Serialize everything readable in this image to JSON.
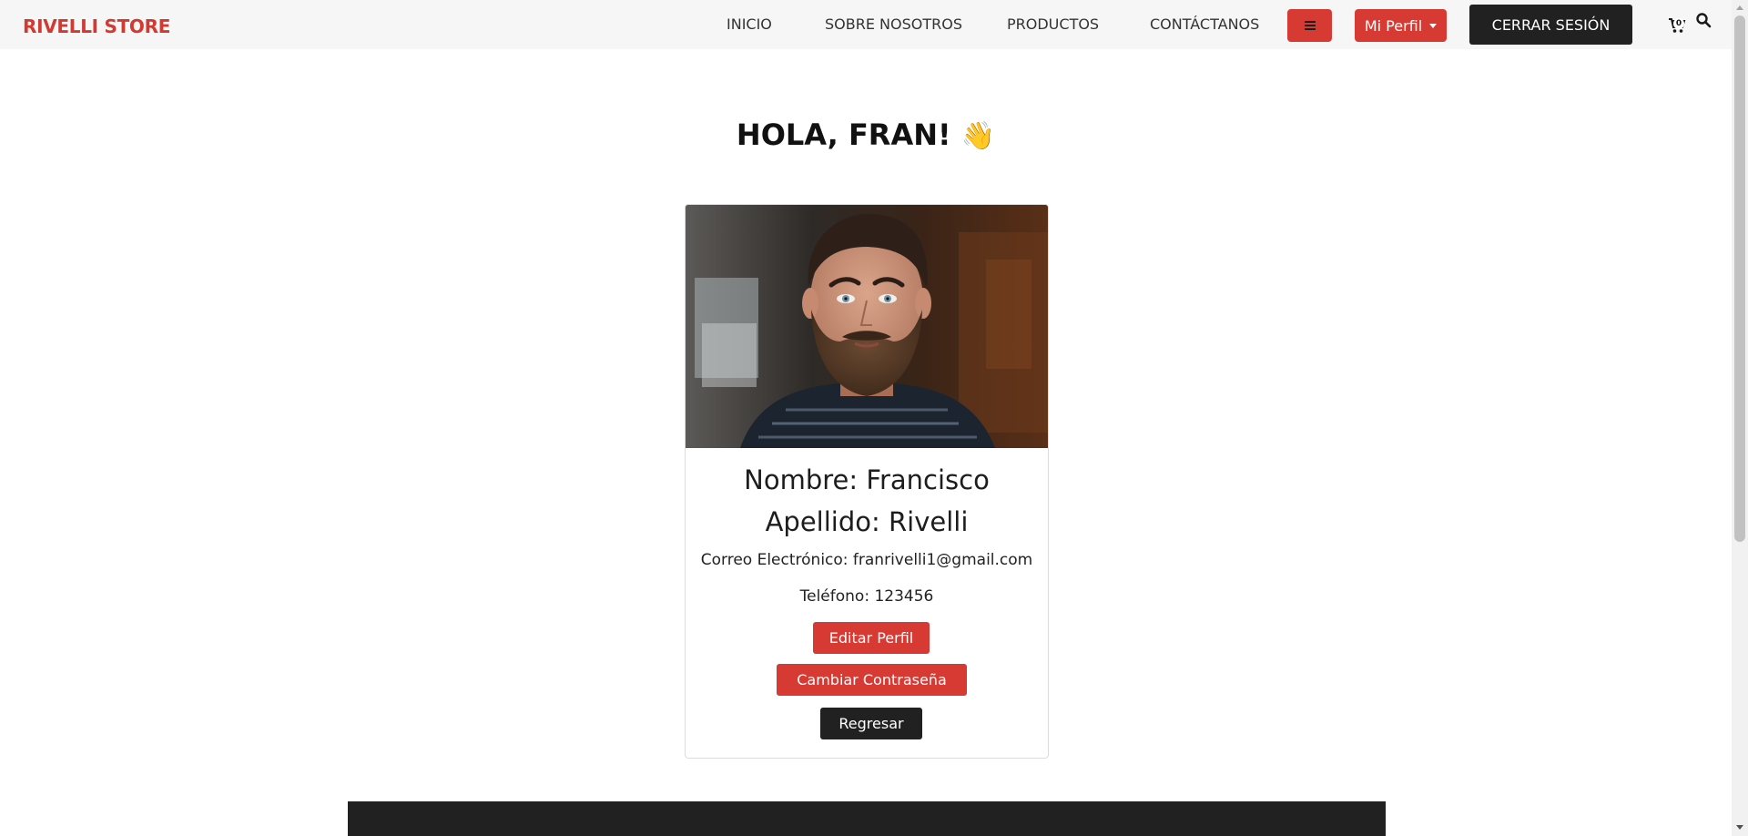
{
  "navbar": {
    "brand": "RIVELLI STORE",
    "links": [
      "INICIO",
      "SOBRE NOSOTROS",
      "PRODUCTOS",
      "CONTÁCTANOS"
    ],
    "menu_icon": "hamburger-icon",
    "profile_label": "Mi Perfil",
    "logout_label": "CERRAR SESIÓN",
    "cart_icon": "cart-icon",
    "cart_count": "0",
    "search_icon": "search-icon"
  },
  "greeting": {
    "text": "HOLA, FRAN!",
    "emoji": "👋"
  },
  "profile": {
    "photo_alt": "foto de perfil",
    "name_line": "Nombre: Francisco",
    "surname_line": "Apellido: Rivelli",
    "email_line": "Correo Electrónico: franrivelli1@gmail.com",
    "phone_line": "Teléfono: 123456"
  },
  "actions": {
    "edit_label": "Editar Perfil",
    "password_label": "Cambiar Contraseña",
    "back_label": "Regresar"
  },
  "colors": {
    "brand": "#d03a32",
    "primary_button": "#d63a33",
    "dark_button": "#212121",
    "navbar_bg": "#f6f6f6"
  }
}
